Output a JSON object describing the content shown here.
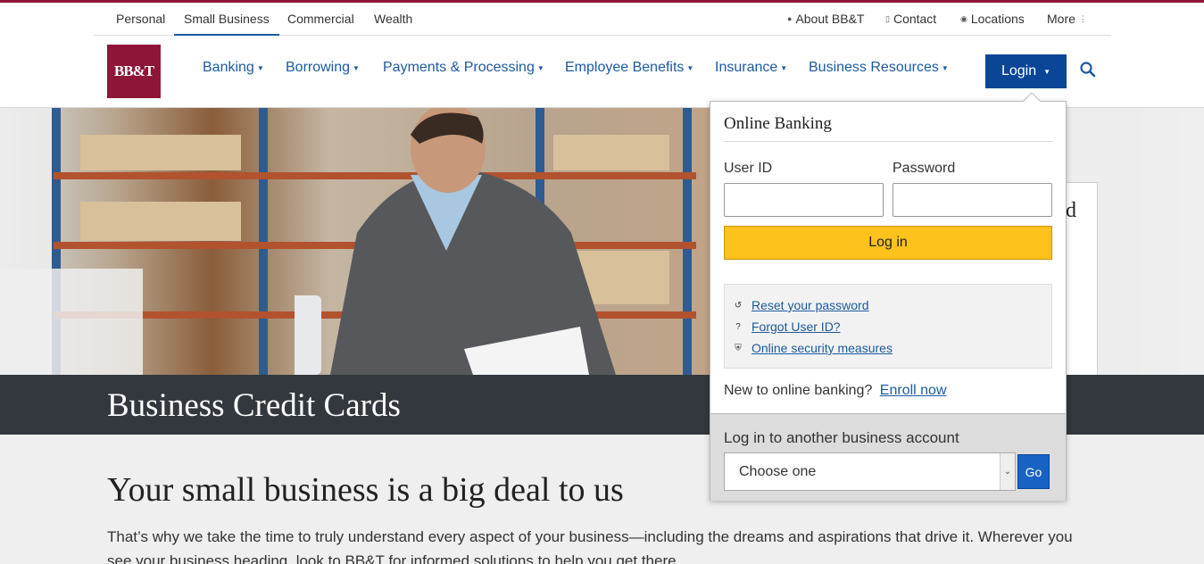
{
  "brand": {
    "logo_text": "BB&T",
    "accent_color": "#8e1537",
    "link_color": "#1c5aa1"
  },
  "util_nav": {
    "segments": [
      {
        "label": "Personal"
      },
      {
        "label": "Small Business",
        "active": true
      },
      {
        "label": "Commercial"
      },
      {
        "label": "Wealth"
      }
    ],
    "right_links": [
      {
        "label": "About BB&T",
        "icon": "person-icon"
      },
      {
        "label": "Contact",
        "icon": "phone-icon"
      },
      {
        "label": "Locations",
        "icon": "map-pin-icon"
      },
      {
        "label": "More",
        "icon": "more-vertical-icon"
      }
    ]
  },
  "main_nav": {
    "items": [
      {
        "label": "Banking"
      },
      {
        "label": "Borrowing"
      },
      {
        "label": "Payments & Processing"
      },
      {
        "label": "Employee Benefits"
      },
      {
        "label": "Insurance"
      },
      {
        "label": "Business Resources"
      }
    ],
    "login_label": "Login",
    "search_icon": "search-icon"
  },
  "page": {
    "title": "Business Credit Cards",
    "section_heading": "Your small business is a big deal to us",
    "body_text": "That’s why we take the time to truly understand every aspect of your business—including the dreams and aspirations that drive it. Wherever you see your business heading, look to BB&T for informed solutions to help you get there."
  },
  "background_card": {
    "visible_text": "d"
  },
  "login_dropdown": {
    "title": "Online Banking",
    "user_id_label": "User ID",
    "user_id_value": "",
    "password_label": "Password",
    "password_value": "",
    "submit_label": "Log in",
    "help_links": [
      {
        "label": "Reset your password",
        "icon": "refresh-icon"
      },
      {
        "label": "Forgot User ID?",
        "icon": "question-icon"
      },
      {
        "label": "Online security measures",
        "icon": "shield-icon"
      }
    ],
    "enroll_prompt": "New to online banking?",
    "enroll_link": "Enroll now",
    "other_account_label": "Log in to another business account",
    "other_account_selected": "Choose one",
    "go_label": "Go"
  }
}
